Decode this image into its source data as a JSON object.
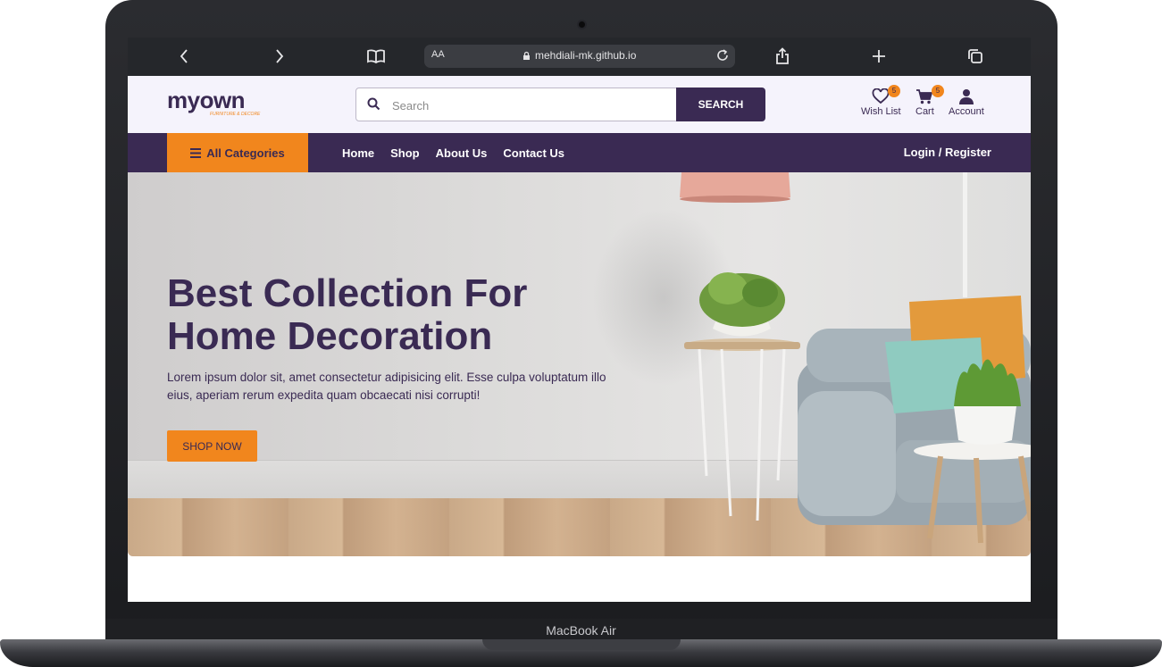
{
  "device": {
    "label": "MacBook Air"
  },
  "browser": {
    "text_size_label": "AA",
    "url": "mehdiali-mk.github.io"
  },
  "site": {
    "logo": {
      "name": "myown",
      "tagline": "FURNITURE & DECORE"
    },
    "search": {
      "placeholder": "Search",
      "button_label": "SEARCH"
    },
    "header_actions": [
      {
        "label": "Wish List",
        "badge": "5",
        "icon": "heart-icon"
      },
      {
        "label": "Cart",
        "badge": "5",
        "icon": "cart-icon"
      },
      {
        "label": "Account",
        "icon": "user-icon"
      }
    ],
    "nav": {
      "all_categories": "All Categories",
      "links": [
        "Home",
        "Shop",
        "About Us",
        "Contact Us"
      ],
      "login": "Login",
      "separator": "/",
      "register": "Register"
    },
    "hero": {
      "title_line1": "Best Collection For",
      "title_line2": "Home Decoration",
      "text": "Lorem ipsum dolor sit, amet consectetur adipisicing elit. Esse culpa voluptatum illo eius, aperiam rerum expedita quam obcaecati nisi corrupti!",
      "button_label": "SHOP NOW"
    }
  },
  "colors": {
    "brand_primary": "#3a2a53",
    "brand_accent": "#f1861d",
    "browser_toolbar": "#25272b"
  }
}
